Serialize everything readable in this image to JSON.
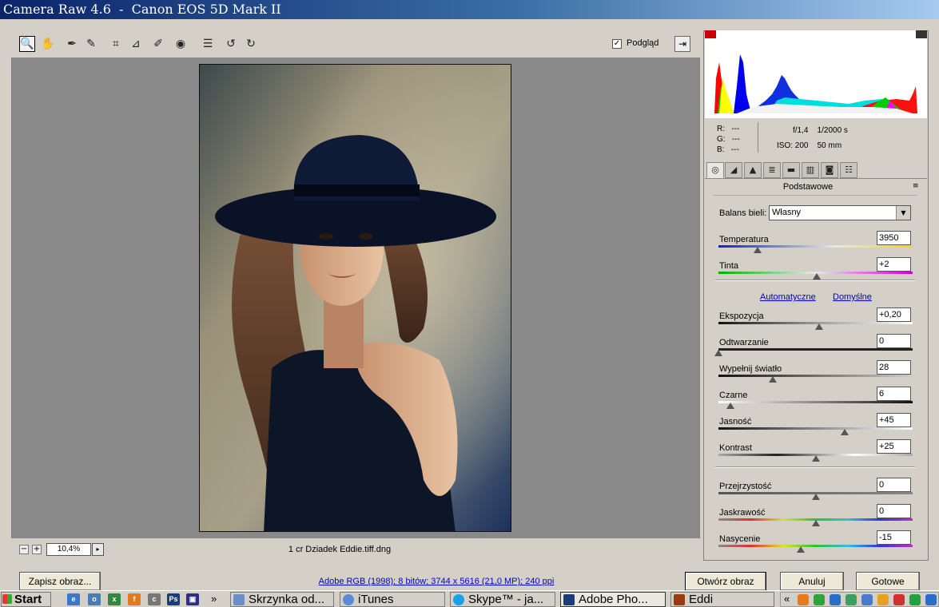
{
  "window": {
    "title": "Camera Raw 4.6  -  Canon EOS 5D Mark II"
  },
  "toolbar": {
    "tools": [
      "zoom-icon",
      "hand-icon",
      "white-balance-icon",
      "color-sampler-icon",
      "crop-icon",
      "straighten-icon",
      "retouch-icon",
      "red-eye-icon",
      "preferences-icon",
      "rotate-left-icon",
      "rotate-right-icon"
    ],
    "preview_label": "Podgląd",
    "preview_checked": "✓"
  },
  "viewer": {
    "zoom_minus": "−",
    "zoom_plus": "+",
    "zoom_value": "10,4%",
    "zoom_dropdown": "▸",
    "filename": "1 cr Dziadek Eddie.tiff.dng"
  },
  "info": {
    "r": "R:   ---",
    "g": "G:   ---",
    "b": "B:   ---",
    "aperture_shutter": "f/1,4    1/2000 s",
    "iso_focal": "ISO: 200    50 mm"
  },
  "panel": {
    "title": "Podstawowe",
    "menu_icon": "≡",
    "white_balance": {
      "label": "Balans bieli:",
      "value": "Własny"
    },
    "links": {
      "auto": "Automatyczne",
      "default": "Domyślne"
    },
    "sliders": [
      {
        "label": "Temperatura",
        "value": "3950",
        "position": 0.2
      },
      {
        "label": "Tinta",
        "value": "+2",
        "position": 0.505
      },
      {
        "label": "Ekspozycja",
        "value": "+0,20",
        "position": 0.52
      },
      {
        "label": "Odtwarzanie",
        "value": "0",
        "position": 0.0
      },
      {
        "label": "Wypełnij światło",
        "value": "28",
        "position": 0.28
      },
      {
        "label": "Czarne",
        "value": "6",
        "position": 0.06
      },
      {
        "label": "Jasność",
        "value": "+45",
        "position": 0.65
      },
      {
        "label": "Kontrast",
        "value": "+25",
        "position": 0.5
      },
      {
        "label": "Przejrzystość",
        "value": "0",
        "position": 0.5
      },
      {
        "label": "Jaskrawość",
        "value": "0",
        "position": 0.5
      },
      {
        "label": "Nasycenie",
        "value": "-15",
        "position": 0.425
      }
    ]
  },
  "bottom": {
    "save_label": "Zapisz obraz...",
    "info_link": "Adobe RGB (1998); 8 bitów; 3744 x 5616 (21,0 MP); 240 ppi",
    "open_label": "Otwórz obraz",
    "cancel_label": "Anuluj",
    "done_label": "Gotowe"
  },
  "taskbar": {
    "start": "Start",
    "more": "»",
    "tasks": [
      "Skrzynka od...",
      "iTunes",
      "Skype™ - ja...",
      "Adobe Pho...",
      "Eddi"
    ],
    "tray_more": "«",
    "quicklaunch": [
      "ie-icon",
      "outlook-icon",
      "excel-icon",
      "firefox-icon",
      "camera-icon",
      "photoshop-icon",
      "save-icon"
    ]
  }
}
